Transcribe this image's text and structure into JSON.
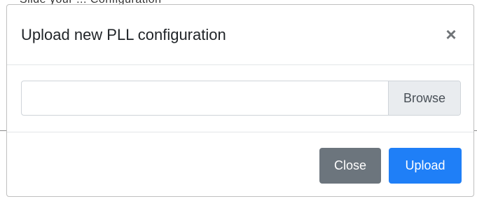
{
  "background": {
    "partial_text": "Slide your ... Configuration"
  },
  "modal": {
    "title": "Upload new PLL configuration",
    "close_icon": "×",
    "file_input": {
      "value": "",
      "browse_label": "Browse"
    },
    "footer": {
      "close_label": "Close",
      "upload_label": "Upload"
    }
  },
  "colors": {
    "close_button": "#6c757d",
    "upload_button": "#1f7ff7",
    "browse_bg": "#e9ecef"
  }
}
